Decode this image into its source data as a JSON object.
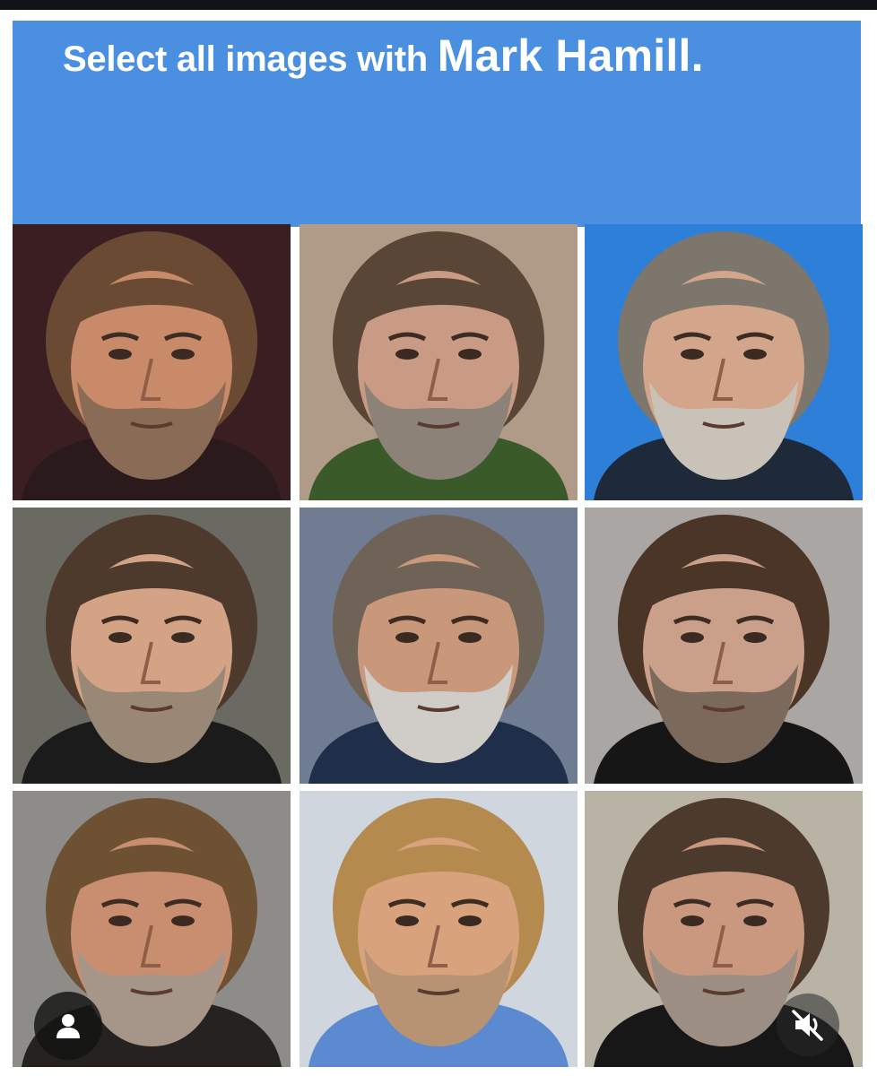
{
  "captcha": {
    "instruction_prefix": "Select all images with ",
    "instruction_target": "Mark Hamill.",
    "header_color": "#4a8fe0"
  },
  "tiles": [
    {
      "index": 1,
      "row": 1,
      "col": 1,
      "bg": "#3a1e22",
      "hair": "#6b4a33",
      "skin": "#c98a6a",
      "beard": "#8a6b55",
      "shirt": "#2a1a1c"
    },
    {
      "index": 2,
      "row": 1,
      "col": 2,
      "bg": "#b09a88",
      "hair": "#5a4636",
      "skin": "#c99a84",
      "beard": "#8c8277",
      "shirt": "#3a5a2a"
    },
    {
      "index": 3,
      "row": 1,
      "col": 3,
      "bg": "#2d7fd8",
      "hair": "#7d766c",
      "skin": "#d3a58a",
      "beard": "#c9c2b8",
      "shirt": "#1e2a3a"
    },
    {
      "index": 4,
      "row": 2,
      "col": 1,
      "bg": "#6a6a62",
      "hair": "#4d3a2c",
      "skin": "#d4a386",
      "beard": "#9a8876",
      "shirt": "#1b1b1b"
    },
    {
      "index": 5,
      "row": 2,
      "col": 2,
      "bg": "#6f7c92",
      "hair": "#6e6356",
      "skin": "#c9977a",
      "beard": "#d0cdc8",
      "shirt": "#1f2f4a"
    },
    {
      "index": 6,
      "row": 2,
      "col": 3,
      "bg": "#a9a6a3",
      "hair": "#4a3526",
      "skin": "#caa08a",
      "beard": "#7b6a5c",
      "shirt": "#161616"
    },
    {
      "index": 7,
      "row": 3,
      "col": 1,
      "bg": "#8d8c88",
      "hair": "#6e5032",
      "skin": "#c98e70",
      "beard": "#a6968a",
      "shirt": "#26221f"
    },
    {
      "index": 8,
      "row": 3,
      "col": 2,
      "bg": "#cfd6de",
      "hair": "#b58a4e",
      "skin": "#d8a27c",
      "beard": "#b79374",
      "shirt": "#5c8ad0"
    },
    {
      "index": 9,
      "row": 3,
      "col": 3,
      "bg": "#b9b3a6",
      "hair": "#4c3a2c",
      "skin": "#c9987e",
      "beard": "#9c8e82",
      "shirt": "#171717"
    }
  ],
  "overlay": {
    "profile_icon": "person-icon",
    "mute_icon": "speaker-muted-icon"
  }
}
